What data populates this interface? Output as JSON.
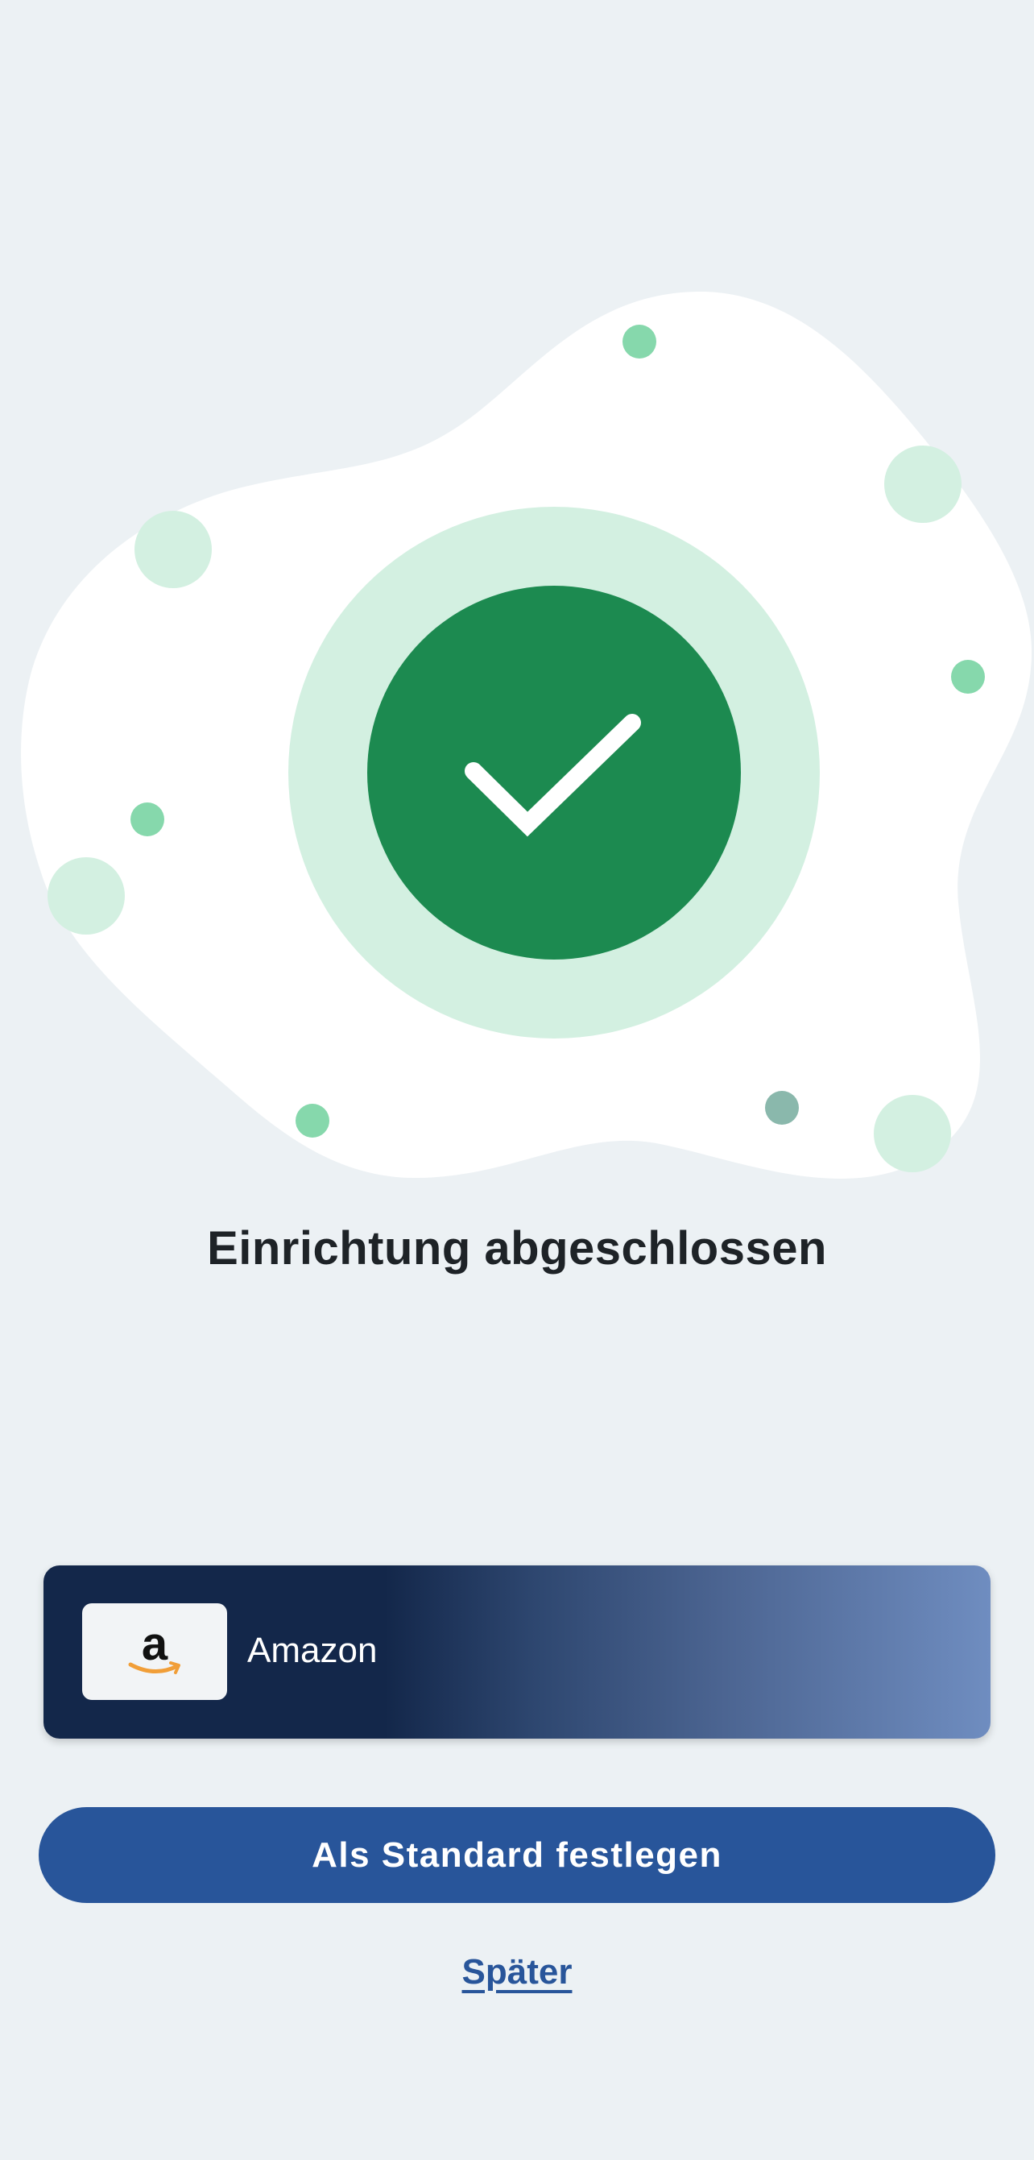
{
  "status": {
    "title": "Einrichtung abgeschlossen",
    "icon": "checkmark-icon"
  },
  "payment_method": {
    "name": "Amazon",
    "logo_icon": "amazon-logo",
    "logo_letter": "a"
  },
  "actions": {
    "primary_label": "Als Standard festlegen",
    "secondary_label": "Später"
  },
  "colors": {
    "background": "#ECF1F4",
    "success_green": "#1C8A50",
    "success_light": "#D3F0E1",
    "primary_blue": "#28559A",
    "card_dark": "#13274A",
    "card_light": "#6F8DC0"
  }
}
